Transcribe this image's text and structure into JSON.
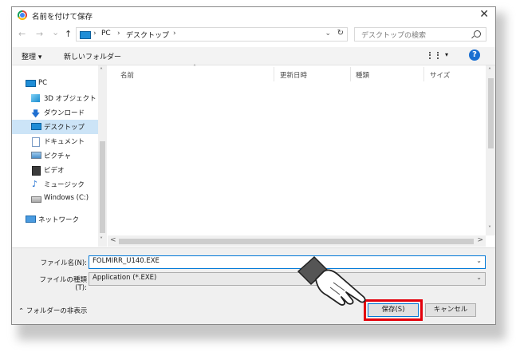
{
  "window": {
    "title": "名前を付けて保存",
    "close_glyph": "✕"
  },
  "nav": {
    "back_glyph": "←",
    "forward_glyph": "→",
    "history_glyph": "⌄",
    "up_glyph": "↑",
    "breadcrumbs": [
      "PC",
      "デスクトップ"
    ],
    "crumb_sep": "›",
    "address_dropdown_glyph": "⌄",
    "refresh_glyph": "↻",
    "search_placeholder": "デスクトップの検索"
  },
  "toolbar": {
    "organize_label": "整理 ▾",
    "new_folder_label": "新しいフォルダー",
    "view_dd_glyph": "▾",
    "help_glyph": "?"
  },
  "sidebar": {
    "items": [
      {
        "label": "PC",
        "icon": "computer-icon"
      },
      {
        "label": "3D オブジェクト",
        "icon": "cube-icon"
      },
      {
        "label": "ダウンロード",
        "icon": "download-icon"
      },
      {
        "label": "デスクトップ",
        "icon": "desktop-icon",
        "selected": true
      },
      {
        "label": "ドキュメント",
        "icon": "document-icon"
      },
      {
        "label": "ピクチャ",
        "icon": "pictures-icon"
      },
      {
        "label": "ビデオ",
        "icon": "video-icon"
      },
      {
        "label": "ミュージック",
        "icon": "music-icon"
      },
      {
        "label": "Windows (C:)",
        "icon": "drive-icon"
      },
      {
        "label": "ネットワーク",
        "icon": "network-icon"
      }
    ],
    "scroll_up_glyph": "˄",
    "scroll_down_glyph": "˅"
  },
  "file_list": {
    "columns": [
      "名前",
      "更新日時",
      "種類",
      "サイズ"
    ],
    "sort_glyph": "˄",
    "scroll_up_glyph": "˄",
    "scroll_down_glyph": "˅",
    "scroll_left_glyph": "<",
    "scroll_right_glyph": ">"
  },
  "form": {
    "filename_label": "ファイル名(N):",
    "filename_value": "FOLMIRR_U140.EXE",
    "filetype_label": "ファイルの種類(T):",
    "filetype_value": "Application (*.EXE)",
    "dropdown_glyph": "⌄"
  },
  "footer": {
    "hide_folders_label": "⌃ フォルダーの非表示",
    "save_label": "保存(S)",
    "cancel_label": "キャンセル"
  },
  "colors": {
    "highlight": "#e3000b",
    "accent": "#0078d7",
    "selected_bg": "#cce4f7"
  }
}
